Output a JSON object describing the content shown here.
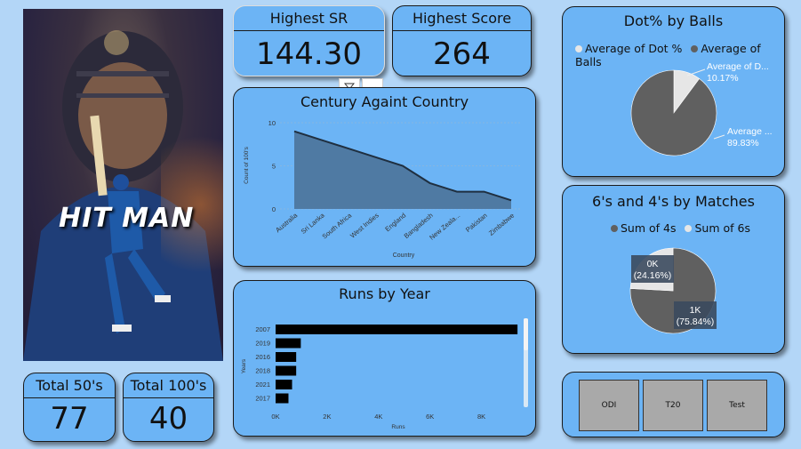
{
  "kpis": {
    "highest_sr": {
      "title": "Highest SR",
      "value": "144.30"
    },
    "highest_score": {
      "title": "Highest Score",
      "value": "264"
    },
    "total_50s": {
      "title": "Total 50's",
      "value": "77"
    },
    "total_100s": {
      "title": "Total 100's",
      "value": "40"
    }
  },
  "photo": {
    "text": "HIT MAN"
  },
  "toolbar": {
    "more_label": "···"
  },
  "dot_chart": {
    "title": "Dot% by Balls",
    "legend": [
      "Average of Dot %",
      "Average of Balls"
    ],
    "label_a": "Average of D...",
    "label_a_value": "10.17%",
    "label_b": "Average ...",
    "label_b_value": "89.83%"
  },
  "boundary_chart": {
    "title": "6's and 4's by Matches",
    "legend": [
      "Sum of 4s",
      "Sum of 6s"
    ],
    "label_a": "0K",
    "label_a_value": "(24.16%)",
    "label_b": "1K",
    "label_b_value": "(75.84%)"
  },
  "format_buttons": [
    "ODI",
    "T20",
    "Test"
  ],
  "colors": {
    "card": "#6cb4f5",
    "background": "#b3d6f7",
    "pie_dark": "#606060",
    "pie_light": "#e6e6e6",
    "area": "#4f7aa3"
  },
  "chart_data": [
    {
      "type": "area",
      "title": "Century Againt Country",
      "xlabel": "Country",
      "ylabel": "Count of 100's",
      "ylim": [
        0,
        10
      ],
      "yticks": [
        "0",
        "5",
        "10"
      ],
      "categories": [
        "Australia",
        "Sri Lanka",
        "South Africa",
        "West Indies",
        "England",
        "Bangladesh",
        "New Zeala...",
        "Pakistan",
        "Zimbabwe"
      ],
      "values": [
        9,
        8,
        7,
        6,
        5,
        3,
        2,
        2,
        1
      ]
    },
    {
      "type": "bar",
      "title": "Runs by Year",
      "xlabel": "Runs",
      "ylabel": "Years",
      "xlim": [
        0,
        9500
      ],
      "xticks": [
        "0K",
        "2K",
        "4K",
        "6K",
        "8K"
      ],
      "categories": [
        "2007",
        "2019",
        "2016",
        "2018",
        "2021",
        "2017"
      ],
      "values": [
        9400,
        980,
        800,
        800,
        640,
        500
      ]
    },
    {
      "type": "pie",
      "title": "Dot% by Balls",
      "labels": [
        "Average of Dot %",
        "Average of Balls"
      ],
      "values": [
        10.17,
        89.83
      ]
    },
    {
      "type": "pie",
      "title": "6's and 4's by Matches",
      "labels": [
        "Sum of 6s",
        "Sum of 4s"
      ],
      "values": [
        24.16,
        75.84
      ]
    }
  ]
}
